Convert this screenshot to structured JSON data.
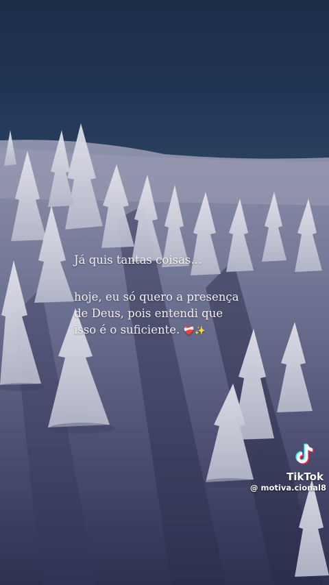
{
  "caption": {
    "line1": "Já quis tantas coisas...",
    "line2": "hoje, eu só quero a presença",
    "line3": "de Deus, pois entendi que",
    "line4": "isso é o suficiente.",
    "emoji": "❤️‍🩹✨"
  },
  "watermark": {
    "brand": "TikTok",
    "handle": "@ motiva.cional8",
    "icon": "tiktok-logo-icon"
  },
  "colors": {
    "sky": "#1f3150",
    "snow": "#c9ccda",
    "text": "#f3f1f4"
  }
}
